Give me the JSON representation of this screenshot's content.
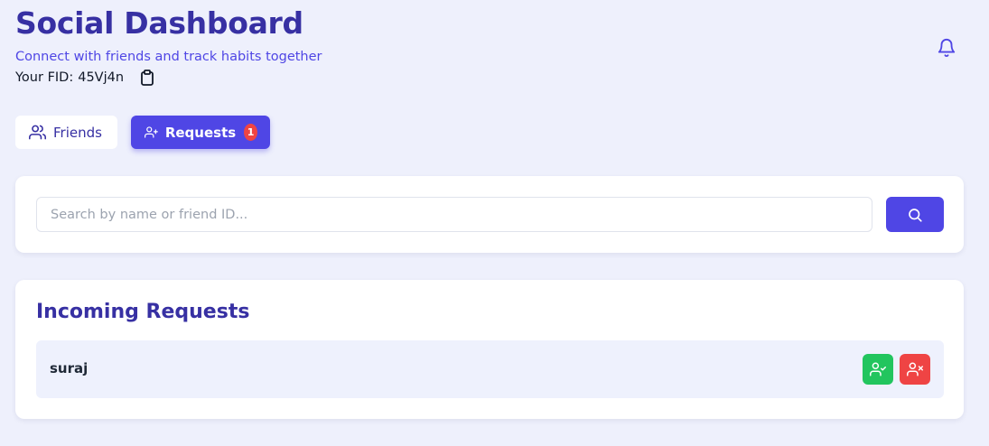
{
  "header": {
    "title": "Social Dashboard",
    "subtitle": "Connect with friends and track habits together",
    "fid_label": "Your FID:",
    "fid_value": "45Vj4n",
    "copy_icon": "clipboard-icon",
    "notification_icon": "bell-icon"
  },
  "tabs": [
    {
      "label": "Friends",
      "icon": "users-icon",
      "active": false
    },
    {
      "label": "Requests",
      "icon": "user-plus-icon",
      "active": true,
      "badge": "1"
    }
  ],
  "search": {
    "placeholder": "Search by name or friend ID...",
    "value": "",
    "button_icon": "search-icon"
  },
  "incoming": {
    "title": "Incoming Requests",
    "requests": [
      {
        "name": "suraj",
        "accept_icon": "user-check-icon",
        "decline_icon": "user-x-icon"
      }
    ]
  },
  "colors": {
    "background": "#eef0fc",
    "primary": "#4f46e5",
    "heading": "#3730a3",
    "accept": "#22c55e",
    "decline": "#ef4444"
  }
}
